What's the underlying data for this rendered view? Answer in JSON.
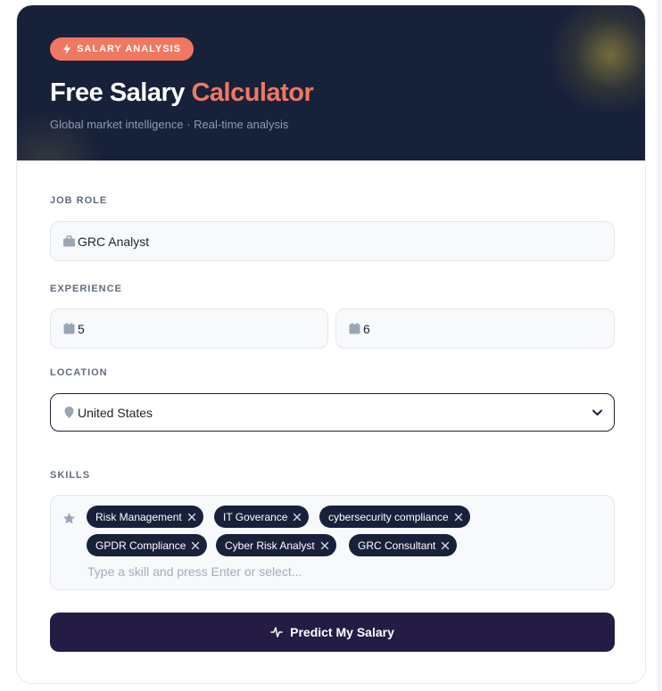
{
  "hero": {
    "badge": "SALARY ANALYSIS",
    "title_main": "Free Salary",
    "title_accent": "Calculator",
    "subtitle": "Global market intelligence · Real-time analysis"
  },
  "form": {
    "job_role": {
      "label": "JOB ROLE",
      "value": "GRC Analyst"
    },
    "experience": {
      "label": "EXPERIENCE",
      "min_value": "5",
      "max_value": "6"
    },
    "location": {
      "label": "LOCATION",
      "value": "United States"
    },
    "skills": {
      "label": "SKILLS",
      "chips": [
        "Risk Management",
        "IT Goverance",
        "cybersecurity compliance",
        "GPDR Compliance",
        "Cyber Risk Analyst",
        "GRC Consultant"
      ],
      "placeholder": "Type a skill and press Enter or select..."
    },
    "submit_label": "Predict My Salary"
  },
  "colors": {
    "hero_bg": "#17213a",
    "accent": "#f07860",
    "button_bg": "#251c45",
    "chip_bg": "#17213a"
  },
  "icons": {
    "badge": "bolt-icon",
    "job_role": "briefcase-icon",
    "experience": "calendar-icon",
    "location": "map-pin-icon",
    "skills": "star-icon",
    "chip_remove": "close-icon",
    "button": "sparkle-icon",
    "select": "chevron-down-icon"
  }
}
